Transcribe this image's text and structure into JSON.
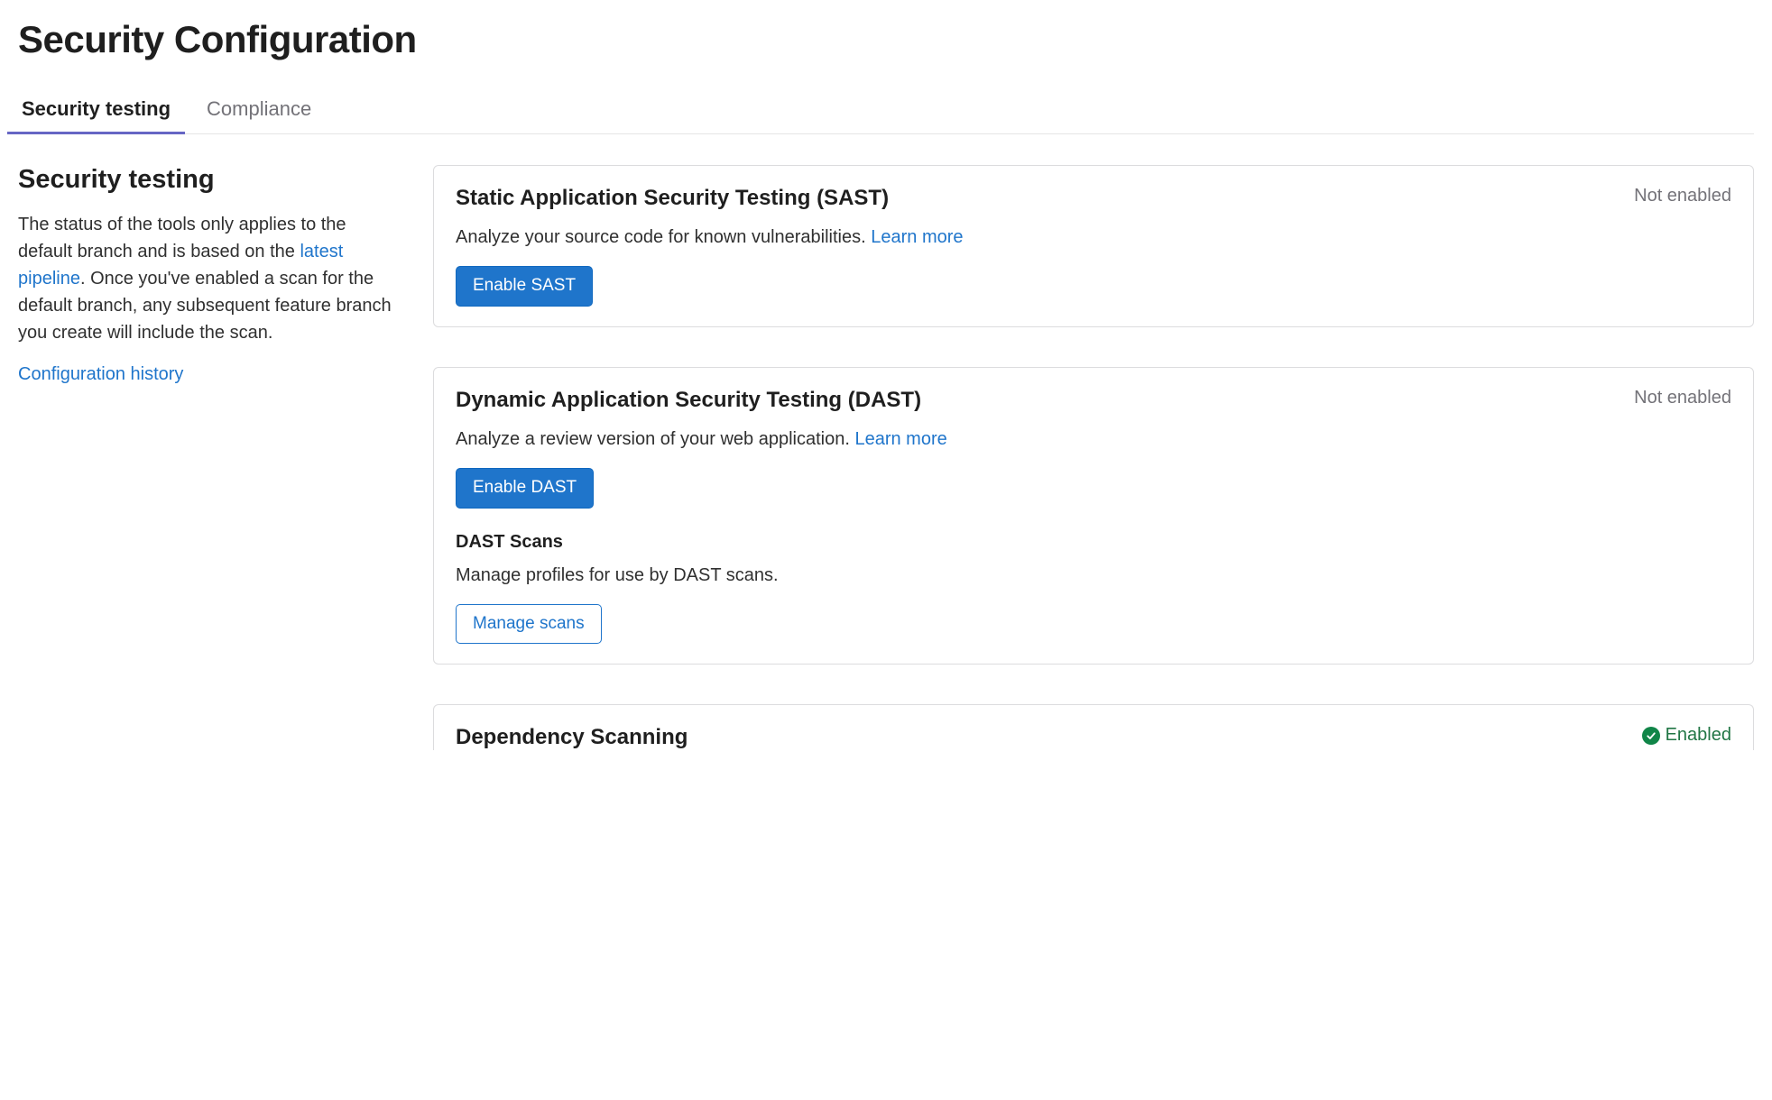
{
  "page": {
    "title": "Security Configuration"
  },
  "tabs": {
    "security_testing": "Security testing",
    "compliance": "Compliance"
  },
  "sidebar": {
    "heading": "Security testing",
    "desc_part1": "The status of the tools only applies to the default branch and is based on the ",
    "desc_link": "latest pipeline",
    "desc_part2": ". Once you've enabled a scan for the default branch, any subsequent feature branch you create will include the scan.",
    "config_history": "Configuration history"
  },
  "cards": {
    "sast": {
      "title": "Static Application Security Testing (SAST)",
      "status": "Not enabled",
      "desc": "Analyze your source code for known vulnerabilities. ",
      "learn_more": "Learn more",
      "button": "Enable SAST"
    },
    "dast": {
      "title": "Dynamic Application Security Testing (DAST)",
      "status": "Not enabled",
      "desc": "Analyze a review version of your web application. ",
      "learn_more": "Learn more",
      "button": "Enable DAST",
      "sub_title": "DAST Scans",
      "sub_desc": "Manage profiles for use by DAST scans.",
      "manage_button": "Manage scans"
    },
    "dependency": {
      "title": "Dependency Scanning",
      "status": "Enabled"
    }
  }
}
